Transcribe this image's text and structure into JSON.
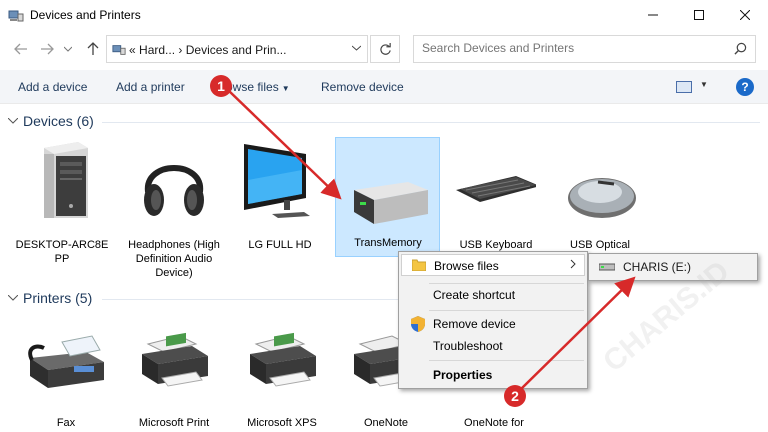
{
  "window": {
    "title": "Devices and Printers"
  },
  "address": {
    "prefix": "«",
    "crumbs": [
      "Hard...",
      "Devices and Prin..."
    ],
    "separator": "›"
  },
  "search": {
    "placeholder": "Search Devices and Printers"
  },
  "commands": {
    "add_device": "Add a device",
    "add_printer": "Add a printer",
    "browse_files": "Browse files",
    "remove_device": "Remove device",
    "help": "?"
  },
  "groups": {
    "devices": {
      "header": "Devices (6)",
      "items": [
        {
          "label": "DESKTOP-ARC8E PP",
          "icon": "computer-tower-icon"
        },
        {
          "label": "Headphones (High Definition Audio Device)",
          "icon": "headphones-icon"
        },
        {
          "label": "LG FULL HD",
          "icon": "monitor-icon"
        },
        {
          "label": "TransMemory",
          "icon": "usb-drive-icon",
          "selected": true
        },
        {
          "label": "USB Keyboard",
          "icon": "keyboard-icon"
        },
        {
          "label": "USB Optical",
          "icon": "mouse-icon"
        }
      ]
    },
    "printers": {
      "header": "Printers (5)",
      "items": [
        {
          "label": "Fax",
          "icon": "fax-icon"
        },
        {
          "label": "Microsoft Print",
          "icon": "printer-icon"
        },
        {
          "label": "Microsoft XPS",
          "icon": "printer-icon"
        },
        {
          "label": "OneNote",
          "icon": "printer-icon"
        },
        {
          "label": "OneNote for",
          "icon": "printer-icon"
        }
      ]
    }
  },
  "context_menu": {
    "items": [
      {
        "label": "Browse files",
        "icon": "folder-icon",
        "has_submenu": true,
        "highlighted": true
      },
      {
        "label": "Create shortcut"
      },
      {
        "label": "Remove device",
        "icon": "shield-icon"
      },
      {
        "label": "Troubleshoot"
      },
      {
        "label": "Properties",
        "bold": true
      }
    ]
  },
  "submenu": {
    "label": "CHARIS (E:)",
    "icon": "drive-icon"
  },
  "annotations": {
    "step1": "1",
    "step2": "2",
    "color": "#d72a2a"
  },
  "watermark": "CHARIS.ID",
  "colors": {
    "selection": "#cce8ff",
    "accent": "#1b6ac9",
    "header_text": "#1e395b"
  }
}
